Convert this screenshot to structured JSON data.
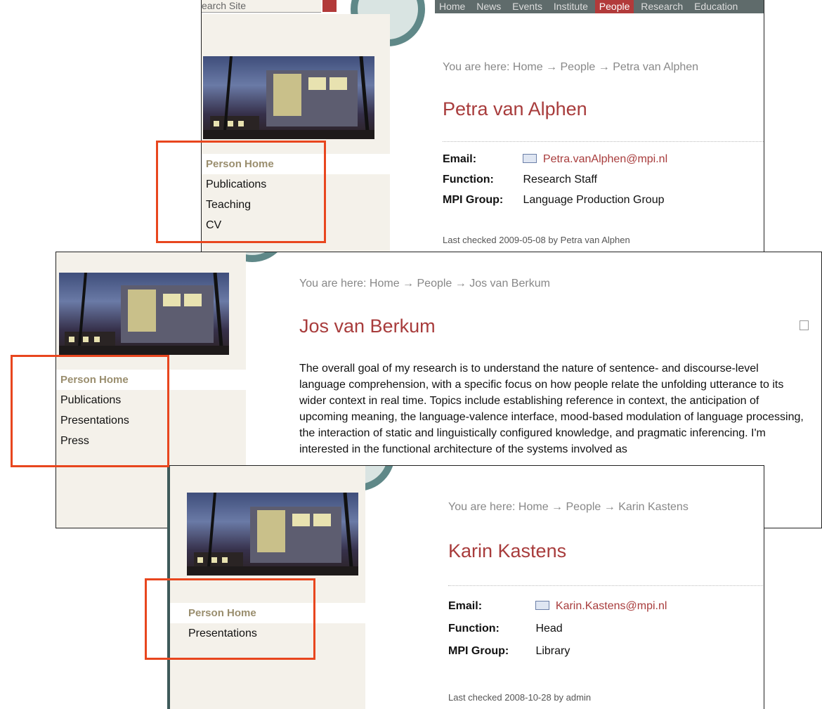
{
  "panels": [
    {
      "id": "alphen",
      "search_placeholder": "earch Site",
      "top_nav": [
        "Home",
        "News",
        "Events",
        "Institute",
        "People",
        "Research",
        "Education"
      ],
      "top_nav_current": "People",
      "nav_items": [
        "Person Home",
        "Publications",
        "Teaching",
        "CV"
      ],
      "breadcrumb": "You are here: Home → People → Petra van Alphen",
      "name": "Petra van Alphen",
      "email_label": "Email:",
      "email_value": "Petra.vanAlphen@mpi.nl",
      "function_label": "Function:",
      "function_value": "Research Staff",
      "group_label": "MPI Group:",
      "group_value": "Language Production Group",
      "last_checked": "Last checked 2009-05-08 by Petra van Alphen"
    },
    {
      "id": "berkum",
      "nav_items": [
        "Person Home",
        "Publications",
        "Presentations",
        "Press"
      ],
      "breadcrumb": "You are here: Home → People → Jos van Berkum",
      "name": "Jos van Berkum",
      "body_text": "The overall goal of my research is to understand the nature of sentence- and discourse-level language comprehension, with a specific focus on how people relate the unfolding utterance to its wider context in real time. Topics include establishing reference in context, the anticipation of upcoming meaning, the language-valence interface, mood-based modulation of language processing, the interaction of static and linguistically configured knowledge, and pragmatic inferencing. I'm interested in the functional architecture of the systems involved as"
    },
    {
      "id": "kastens",
      "nav_items": [
        "Person Home",
        "Presentations"
      ],
      "breadcrumb": "You are here: Home → People → Karin Kastens",
      "name": "Karin Kastens",
      "email_label": "Email:",
      "email_value": "Karin.Kastens@mpi.nl",
      "function_label": "Function:",
      "function_value": "Head",
      "group_label": "MPI Group:",
      "group_value": "Library",
      "last_checked": "Last checked 2008-10-28 by admin"
    }
  ],
  "colors": {
    "highlight": "#e8461e",
    "name": "#a83c3c",
    "sidebar": "#f4f1ea",
    "active_nav": "#9a8e6e",
    "seal": "#5f8888"
  }
}
